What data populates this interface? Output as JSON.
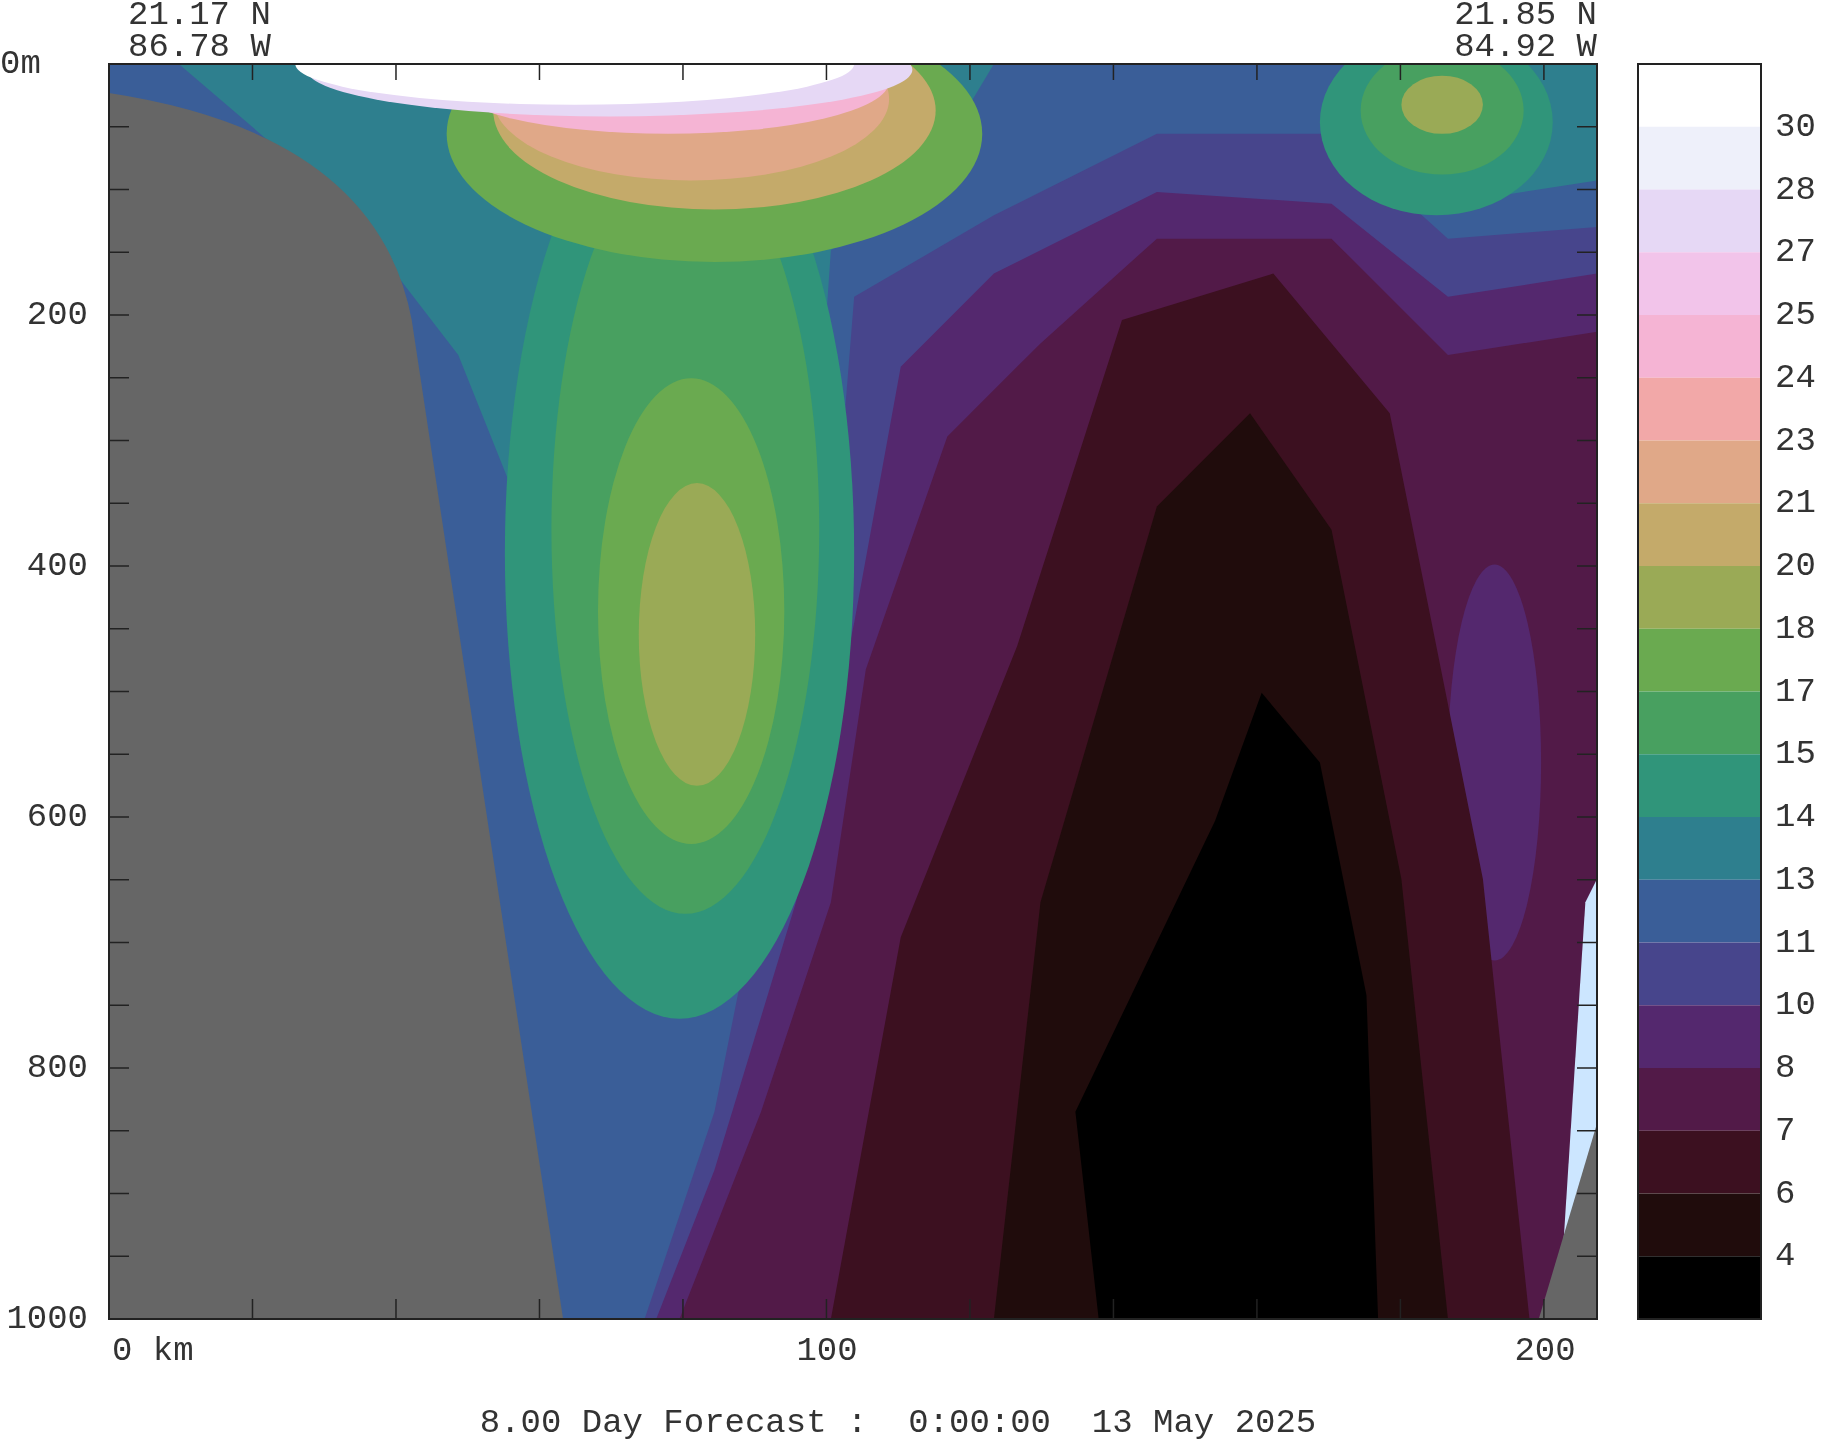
{
  "top_labels": {
    "left": [
      "21.17 N",
      "86.78 W"
    ],
    "right": [
      "21.85 N",
      "84.92 W"
    ]
  },
  "y_axis": {
    "labels": [
      "0m",
      "200",
      "400",
      "600",
      "800",
      "1000"
    ]
  },
  "x_axis": {
    "labels": [
      "0 km",
      "100",
      "200"
    ]
  },
  "colorbar": {
    "bands": [
      {
        "color": "#ffffff"
      },
      {
        "color": "#eef0fa"
      },
      {
        "color": "#e6d8f5"
      },
      {
        "color": "#f2c4ea"
      },
      {
        "color": "#f5b4d4"
      },
      {
        "color": "#f2a8a8"
      },
      {
        "color": "#e0a888"
      },
      {
        "color": "#c4aa6a"
      },
      {
        "color": "#9aaa56"
      },
      {
        "color": "#6aaa50"
      },
      {
        "color": "#48a060"
      },
      {
        "color": "#30957a"
      },
      {
        "color": "#2e7f8e"
      },
      {
        "color": "#3a5e98"
      },
      {
        "color": "#47458c"
      },
      {
        "color": "#54286e"
      },
      {
        "color": "#521a48"
      },
      {
        "color": "#3c1020"
      },
      {
        "color": "#200c0c"
      },
      {
        "color": "#000000"
      }
    ],
    "labels": [
      "30",
      "28",
      "27",
      "25",
      "24",
      "23",
      "21",
      "20",
      "18",
      "17",
      "15",
      "14",
      "13",
      "11",
      "10",
      "8",
      "7",
      "6",
      "4"
    ]
  },
  "caption": "8.00 Day Forecast :  0:00:00  13 May 2025"
}
